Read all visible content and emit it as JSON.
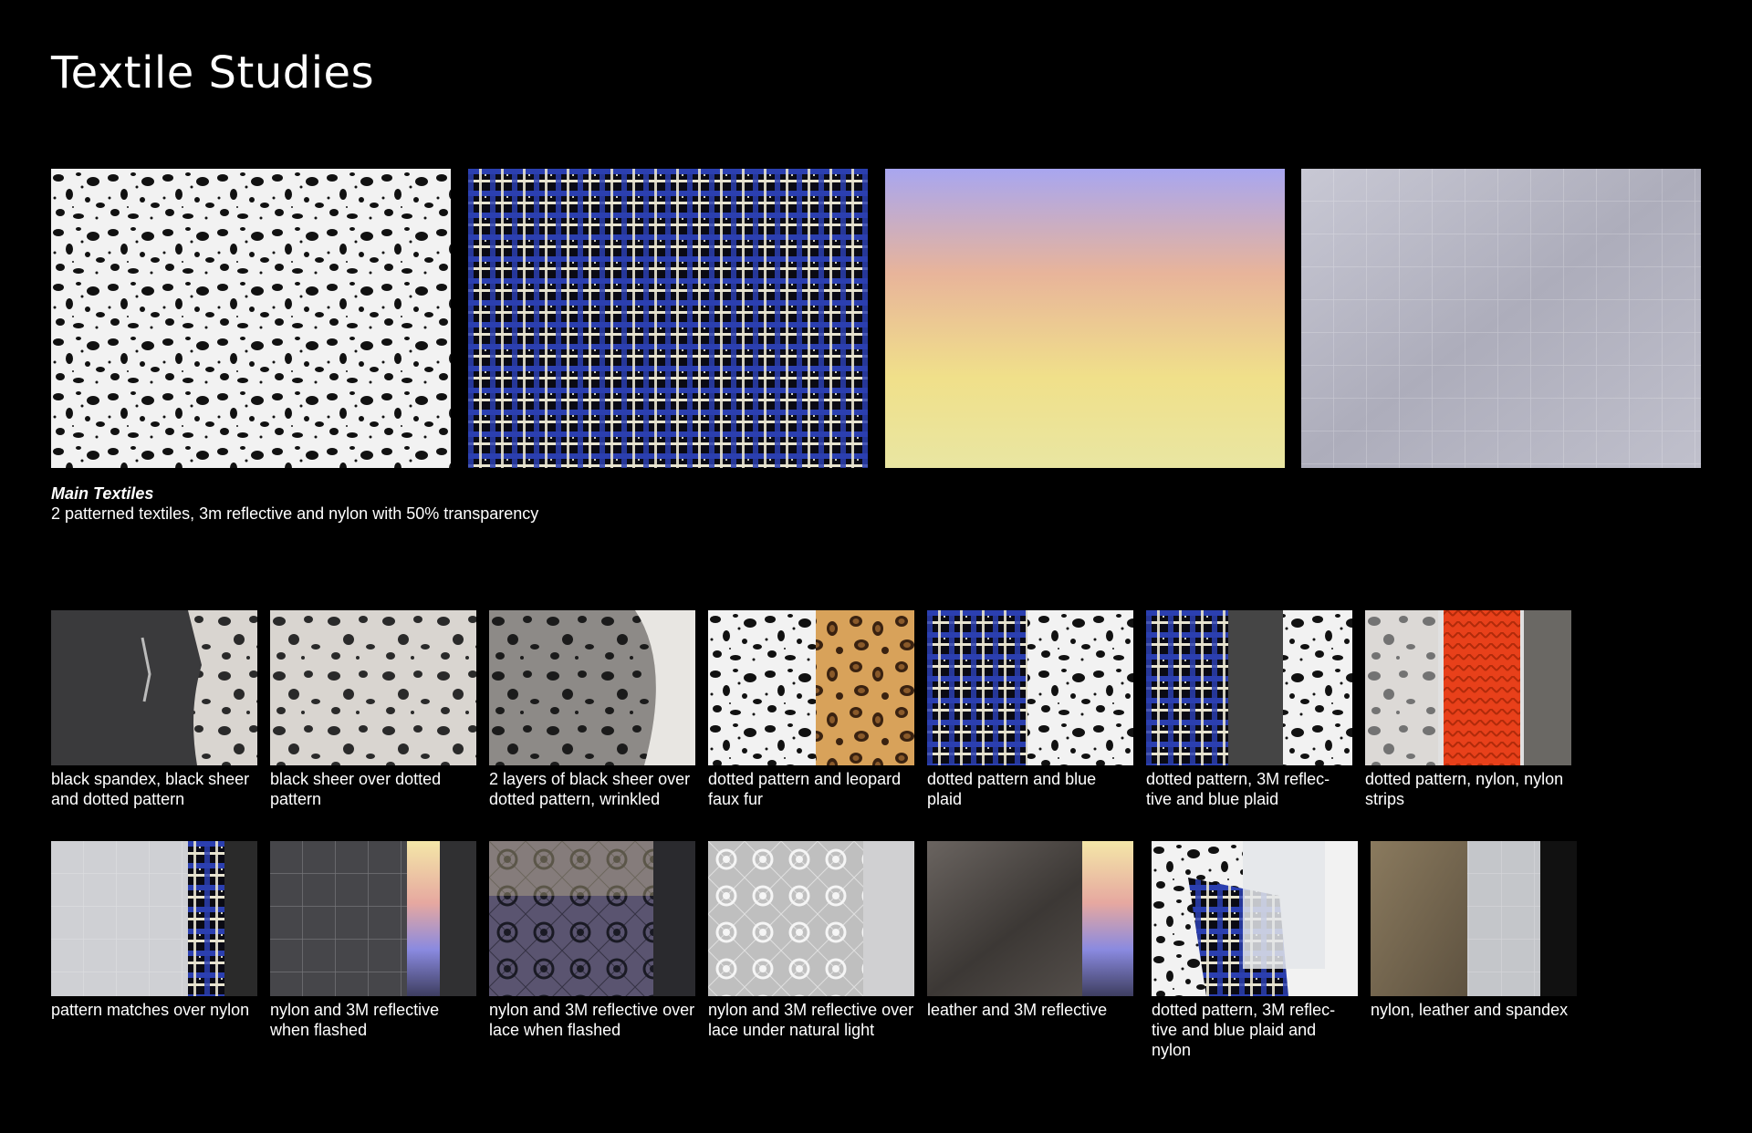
{
  "page": {
    "title": "Textile Studies"
  },
  "main_textiles": {
    "items": [
      {
        "icon": "dotted-pattern-swatch"
      },
      {
        "icon": "blue-plaid-swatch"
      },
      {
        "icon": "3m-reflective-swatch"
      },
      {
        "icon": "nylon-swatch"
      }
    ],
    "caption_title": "Main Textiles",
    "caption_desc": "2 patterned textiles, 3m reflective and nylon with 50% transparency"
  },
  "samples_row1": [
    {
      "label": "black spandex, black sheer and dotted pattern"
    },
    {
      "label": "black sheer over dotted pattern"
    },
    {
      "label": "2 layers of black sheer over dotted pattern, wrinkled"
    },
    {
      "label": "dotted pattern and leopard faux fur"
    },
    {
      "label": "dotted pattern and blue plaid"
    },
    {
      "label": "dotted pattern, 3M reflec-tive and blue plaid"
    },
    {
      "label": "dotted pattern, nylon, nylon strips"
    }
  ],
  "samples_row2": [
    {
      "label": "pattern matches over nylon"
    },
    {
      "label": "nylon and 3M reflective when flashed"
    },
    {
      "label": "nylon and 3M reflective over lace when flashed"
    },
    {
      "label": "nylon and 3M reflective over lace under natural light"
    },
    {
      "label": "leather and 3M reflective"
    },
    {
      "label": "dotted pattern, 3M reflec-tive and blue plaid and nylon"
    },
    {
      "label": "nylon, leather and spandex"
    }
  ]
}
